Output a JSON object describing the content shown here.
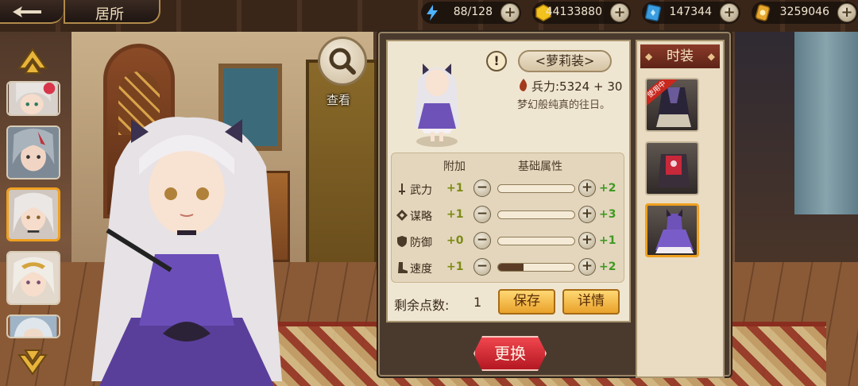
{
  "header": {
    "title": "居所"
  },
  "resources": [
    {
      "icon": "lightning-icon",
      "value": "88/128"
    },
    {
      "icon": "gold-coin-icon",
      "value": "44133880"
    },
    {
      "icon": "blue-gem-card-icon",
      "value": "147344"
    },
    {
      "icon": "gold-token-icon",
      "value": "3259046"
    }
  ],
  "inspect": {
    "label": "查看"
  },
  "costume": {
    "name": "<萝莉装>",
    "power": "兵力:5324 + 30",
    "description": "梦幻般纯真的往日。"
  },
  "stats": {
    "col_add": "附加",
    "col_base": "基础属性",
    "rows": [
      {
        "name": "武力",
        "icon": "sword-icon",
        "add": "+1",
        "base": "+2",
        "fill": 0.0
      },
      {
        "name": "谋略",
        "icon": "diamond-book-icon",
        "add": "+1",
        "base": "+3",
        "fill": 0.0
      },
      {
        "name": "防御",
        "icon": "shield-icon",
        "add": "+0",
        "base": "+1",
        "fill": 0.0
      },
      {
        "name": "速度",
        "icon": "boot-icon",
        "add": "+1",
        "base": "+2",
        "fill": 0.33
      }
    ]
  },
  "remaining": {
    "label": "剩余点数:",
    "value": "1"
  },
  "buttons": {
    "save": "保存",
    "details": "详情",
    "change": "更换"
  },
  "costume_list": {
    "title": "时装",
    "in_use": "使用中",
    "items": [
      {
        "name": "dark-robe-outfit",
        "in_use": true,
        "selected": false
      },
      {
        "name": "red-armor-outfit",
        "in_use": false,
        "selected": false
      },
      {
        "name": "purple-dress-outfit",
        "in_use": false,
        "selected": true
      }
    ]
  },
  "colors": {
    "accent": "#f0a020",
    "plus_green": "#3f9a22",
    "add_yellow": "#7d8a12",
    "change_red": "#c8232b"
  }
}
